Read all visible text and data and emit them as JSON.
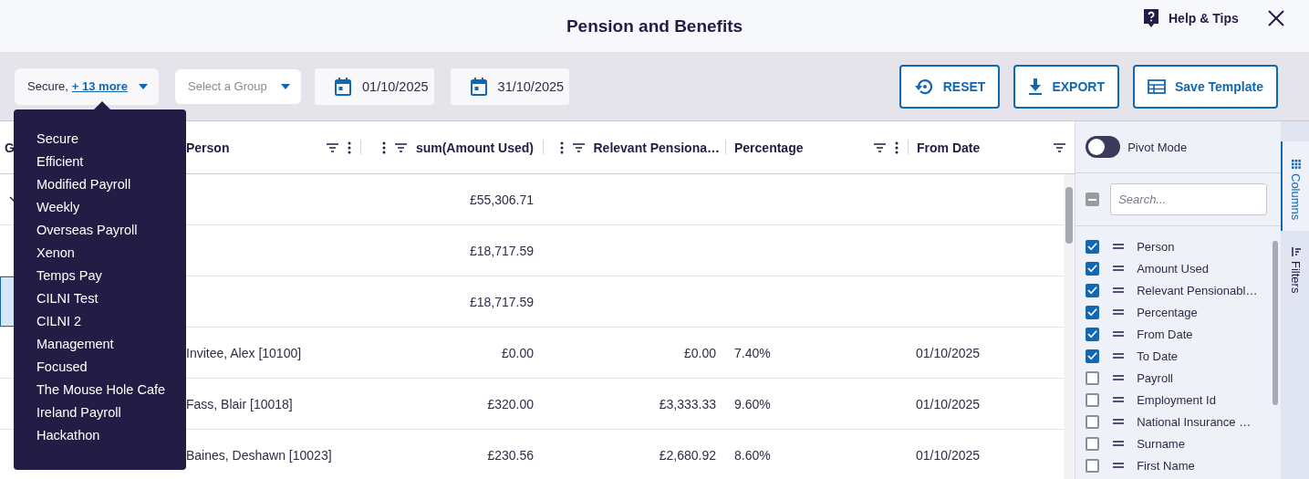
{
  "header": {
    "title": "Pension and Benefits",
    "help": "Help & Tips"
  },
  "toolbar": {
    "payroll_filter": {
      "value": "Secure,",
      "more": "+ 13 more"
    },
    "group_select": {
      "placeholder": "Select a Group"
    },
    "date_from": "01/10/2025",
    "date_to": "31/10/2025",
    "buttons": [
      {
        "kind": "reset",
        "label": "RESET"
      },
      {
        "kind": "export",
        "label": "EXPORT"
      },
      {
        "kind": "template",
        "label": "Save Template"
      }
    ]
  },
  "payroll_menu": {
    "items": [
      "Secure",
      "Efficient",
      "Modified Payroll",
      "Weekly",
      "Overseas Payroll",
      "Xenon",
      "Temps Pay",
      "CILNI Test",
      "CILNI 2",
      "Management",
      "Focused",
      "The Mouse Hole Cafe",
      "Ireland Payroll",
      "Hackathon"
    ]
  },
  "table": {
    "columns": [
      {
        "label": "G",
        "kind": "text"
      },
      {
        "label": "Person",
        "kind": "text",
        "filter": true,
        "menu": true
      },
      {
        "label": "sum(Amount Used)",
        "kind": "number",
        "filter": true,
        "menu": true
      },
      {
        "label": "Relevant Pensiona…",
        "kind": "number",
        "filter": true,
        "menu": true
      },
      {
        "label": "Percentage",
        "kind": "text",
        "filter": true,
        "menu": true
      },
      {
        "label": "From Date",
        "kind": "text",
        "filter": true,
        "menu": false
      }
    ],
    "rows": [
      {
        "kind": "group",
        "expanded": true,
        "selected": false,
        "amount": "£55,306.71"
      },
      {
        "kind": "subtotal",
        "selected": false,
        "amount": "£18,717.59"
      },
      {
        "kind": "subtotal",
        "selected": true,
        "amount": "£18,717.59"
      },
      {
        "kind": "data",
        "selected": false,
        "person": "Invitee, Alex [10100]",
        "amount": "£0.00",
        "relevant": "£0.00",
        "percentage": "7.40%",
        "from_date": "01/10/2025"
      },
      {
        "kind": "data",
        "selected": false,
        "person": "Fass, Blair [10018]",
        "amount": "£320.00",
        "relevant": "£3,333.33",
        "percentage": "9.60%",
        "from_date": "01/10/2025"
      },
      {
        "kind": "data",
        "selected": false,
        "person": "Baines, Deshawn [10023]",
        "amount": "£230.56",
        "relevant": "£2,680.92",
        "percentage": "8.60%",
        "from_date": "01/10/2025"
      }
    ]
  },
  "side_panel": {
    "pivot_mode": {
      "label": "Pivot Mode",
      "on": false
    },
    "select_all": {
      "indeterminate": true
    },
    "search": {
      "placeholder": "Search..."
    },
    "columns": [
      {
        "label": "Person",
        "checked": true
      },
      {
        "label": "Amount Used",
        "checked": true
      },
      {
        "label": "Relevant Pensionabl…",
        "checked": true
      },
      {
        "label": "Percentage",
        "checked": true
      },
      {
        "label": "From Date",
        "checked": true
      },
      {
        "label": "To Date",
        "checked": true
      },
      {
        "label": "Payroll",
        "checked": false
      },
      {
        "label": "Employment Id",
        "checked": false
      },
      {
        "label": "National Insurance …",
        "checked": false
      },
      {
        "label": "Surname",
        "checked": false
      },
      {
        "label": "First Name",
        "checked": false
      }
    ],
    "tabs": [
      {
        "label": "Columns",
        "kind": "columns",
        "selected": true
      },
      {
        "label": "Filters",
        "kind": "filters",
        "selected": false
      }
    ]
  }
}
